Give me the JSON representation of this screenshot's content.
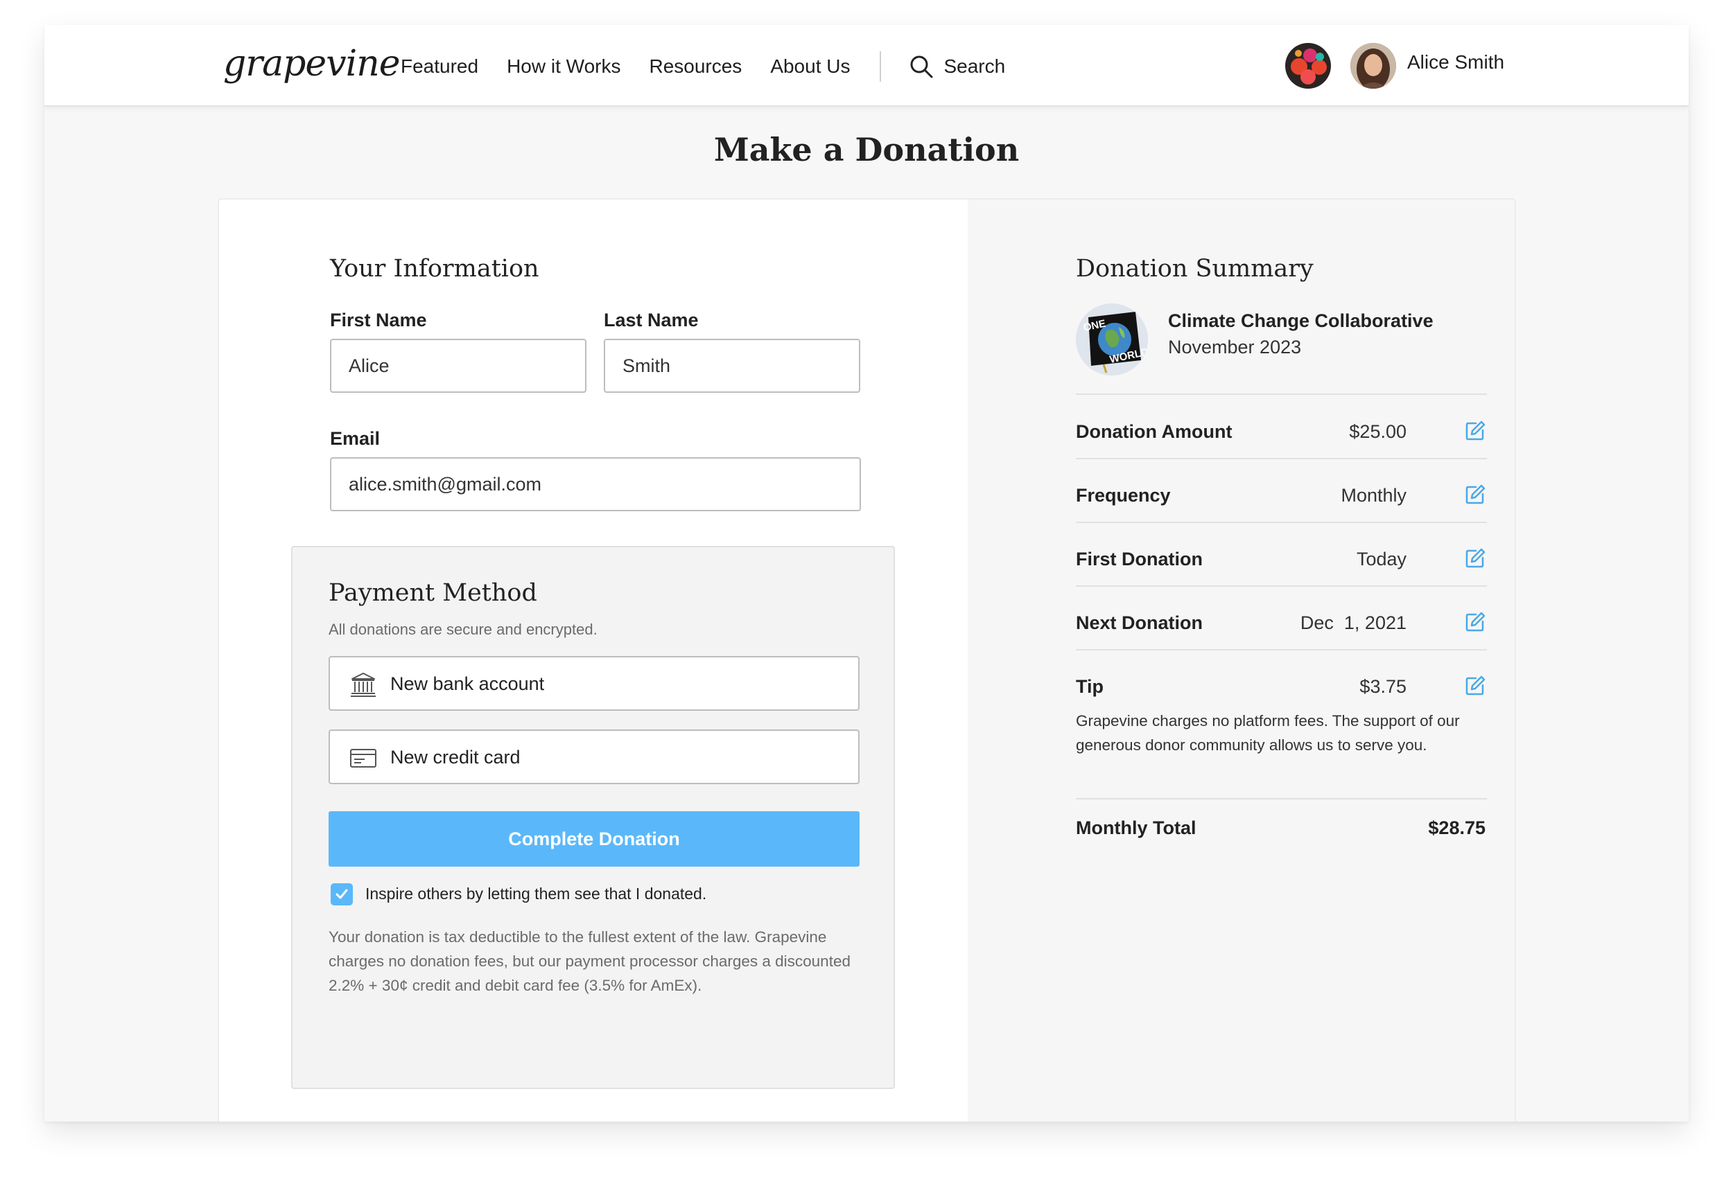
{
  "brand": {
    "logo_text": "grapevine"
  },
  "nav": {
    "links": [
      "Featured",
      "How it Works",
      "Resources",
      "About Us"
    ],
    "search_label": "Search"
  },
  "user": {
    "name": "Alice Smith"
  },
  "page": {
    "title": "Make a Donation"
  },
  "your_info": {
    "title": "Your Information",
    "first_name_label": "First Name",
    "first_name_value": "Alice",
    "last_name_label": "Last Name",
    "last_name_value": "Smith",
    "email_label": "Email",
    "email_value": "alice.smith@gmail.com"
  },
  "payment": {
    "title": "Payment Method",
    "subtitle": "All donations are secure and encrypted.",
    "options": [
      {
        "label": "New bank account",
        "icon": "bank-icon"
      },
      {
        "label": "New credit card",
        "icon": "credit-card-icon"
      }
    ],
    "complete_label": "Complete Donation",
    "inspire_label": "Inspire others by letting them see that I donated.",
    "inspire_checked": true,
    "disclaimer": "Your donation is tax deductible to the fullest extent of the law. Grapevine charges no donation fees, but our payment processor charges a discounted 2.2% + 30¢ credit and debit card fee (3.5% for AmEx)."
  },
  "summary": {
    "title": "Donation Summary",
    "org_name": "Climate Change Collaborative",
    "org_date": "November 2023",
    "org_logo_text": "ONE WORLD",
    "rows": [
      {
        "label": "Donation Amount",
        "value": "$25.00"
      },
      {
        "label": "Frequency",
        "value": "Monthly"
      },
      {
        "label": "First Donation",
        "value": "Today"
      },
      {
        "label": "Next Donation",
        "value": "Dec  1, 2021"
      },
      {
        "label": "Tip",
        "value": "$3.75"
      }
    ],
    "tip_note": "Grapevine charges no platform fees. The support of our generous donor community allows us to serve you.",
    "total_label": "Monthly Total",
    "total_value": "$28.75"
  },
  "colors": {
    "accent": "#5ab8fa",
    "edit_icon": "#4aa8e6",
    "page_bg": "#f7f7f7",
    "text": "#222222"
  }
}
